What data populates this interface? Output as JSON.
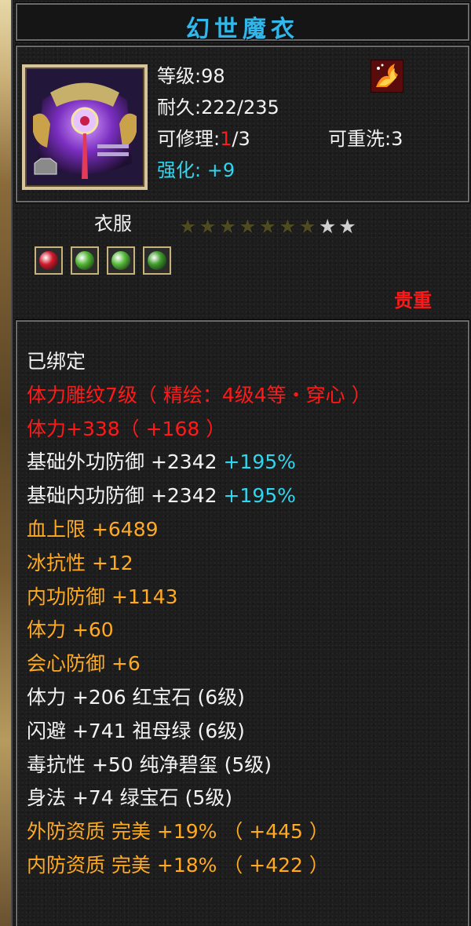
{
  "item": {
    "name": "幻世魔衣",
    "level_label": "等级:98",
    "durability_label": "耐久:222/235",
    "repair_prefix": "可修理:",
    "repair_current": "1",
    "repair_suffix": "/3",
    "rewash_label": "可重洗:3",
    "enhance_label": "强化:",
    "enhance_value": "+9",
    "type_label": "衣服",
    "rarity_label": "贵重",
    "stars_filled": 7,
    "stars_total": 9,
    "icon": "purple-armor-icon",
    "badge_icon": "phoenix-flame-icon"
  },
  "gems": [
    {
      "name": "ruby-gem-icon",
      "color": "#d1192b"
    },
    {
      "name": "emerald-gem-icon",
      "color": "#4fb431"
    },
    {
      "name": "emerald-gem-icon",
      "color": "#56ba3a"
    },
    {
      "name": "jade-gem-icon",
      "color": "#3d9a2a"
    }
  ],
  "attributes": [
    {
      "text": "已绑定",
      "color": "#f2f2f2"
    },
    {
      "text": "体力雕纹7级（ 精绘：4级4等・穿心 ）",
      "color": "#ff1a1a"
    },
    {
      "text": "体力+338（ +168 ）",
      "color": "#ff1a1a"
    },
    {
      "text": "基础外功防御 +2342",
      "extra": " +195%",
      "color": "#f2f2f2",
      "extra_color": "#2fd6ef"
    },
    {
      "text": "基础内功防御 +2342",
      "extra": " +195%",
      "color": "#f2f2f2",
      "extra_color": "#2fd6ef"
    },
    {
      "text": "血上限 +6489",
      "color": "#ffaa22"
    },
    {
      "text": "冰抗性 +12",
      "color": "#ffaa22"
    },
    {
      "text": "内功防御 +1143",
      "color": "#ffaa22"
    },
    {
      "text": "体力 +60",
      "color": "#ffaa22"
    },
    {
      "text": "会心防御 +6",
      "color": "#ffaa22"
    },
    {
      "text": "体力 +206 红宝石 (6级)",
      "color": "#f2f2f2"
    },
    {
      "text": "闪避 +741 祖母绿 (6级)",
      "color": "#f2f2f2"
    },
    {
      "text": "毒抗性 +50 纯净碧玺 (5级)",
      "color": "#f2f2f2"
    },
    {
      "text": "身法 +74 绿宝石 (5级)",
      "color": "#f2f2f2"
    },
    {
      "text": "外防资质   完美 +19% （ +445 ）",
      "color": "#ffaa22"
    },
    {
      "text": "内防资质   完美 +18% （ +422 ）",
      "color": "#ffaa22"
    }
  ]
}
